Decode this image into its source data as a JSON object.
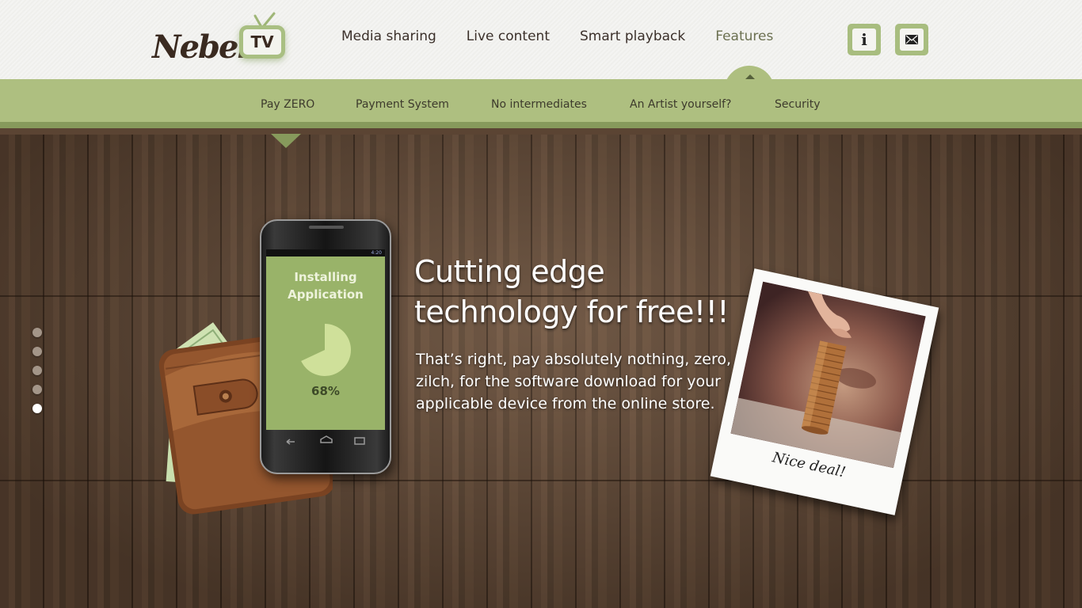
{
  "brand": {
    "logo_word": "Nebel.",
    "logo_tv": "TV"
  },
  "nav": {
    "items": [
      {
        "label": "Media sharing"
      },
      {
        "label": "Live content"
      },
      {
        "label": "Smart playback"
      },
      {
        "label": "Features",
        "active": true
      }
    ]
  },
  "header_buttons": {
    "info_icon": "info-icon",
    "mail_icon": "envelope-icon",
    "info_glyph": "i"
  },
  "subnav": {
    "items": [
      {
        "label": "Pay ZERO",
        "active": true
      },
      {
        "label": "Payment System"
      },
      {
        "label": "No intermediates"
      },
      {
        "label": "An Artist yourself?"
      },
      {
        "label": "Security"
      }
    ]
  },
  "slider": {
    "count": 5,
    "active_index": 4
  },
  "hero": {
    "headline_line1": "Cutting edge",
    "headline_line2": "technology for free!!!",
    "body": "That’s right, pay absolutely nothing, zero, zilch, for the software download for your applicable device from the online store."
  },
  "phone": {
    "status_time": "4:20",
    "title_line1": "Installing",
    "title_line2": "Application",
    "progress_percent": 68,
    "progress_label": "68%"
  },
  "polaroid": {
    "caption": "Nice deal!"
  },
  "colors": {
    "accent_green": "#aebf80",
    "accent_green_dark": "#879a5c",
    "screen_green": "#99b369",
    "pie_green": "#cfe09a",
    "wood": "#5e4534"
  }
}
